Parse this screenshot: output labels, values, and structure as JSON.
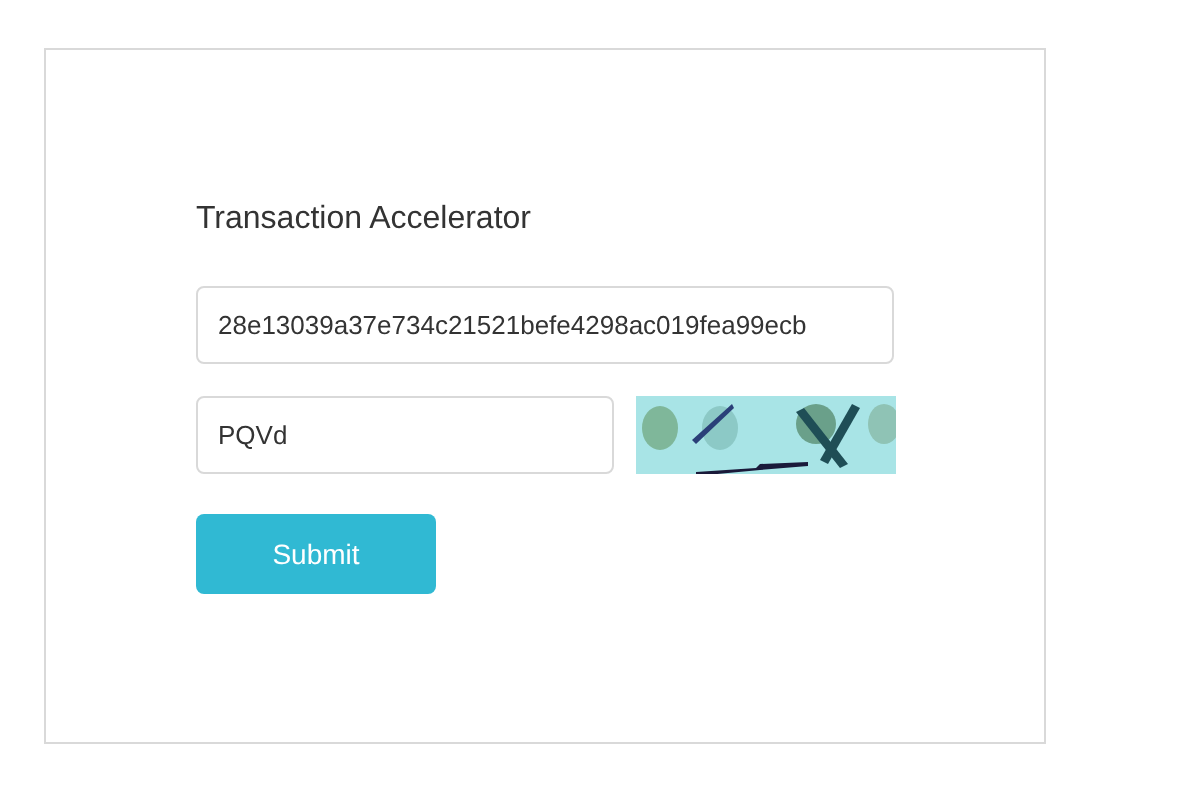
{
  "title": "Transaction Accelerator",
  "txid_field": {
    "value": "28e13039a37e734c21521befe4298ac019fea99ecb"
  },
  "captcha_field": {
    "value": "PQVd"
  },
  "submit_button": {
    "label": "Submit"
  }
}
